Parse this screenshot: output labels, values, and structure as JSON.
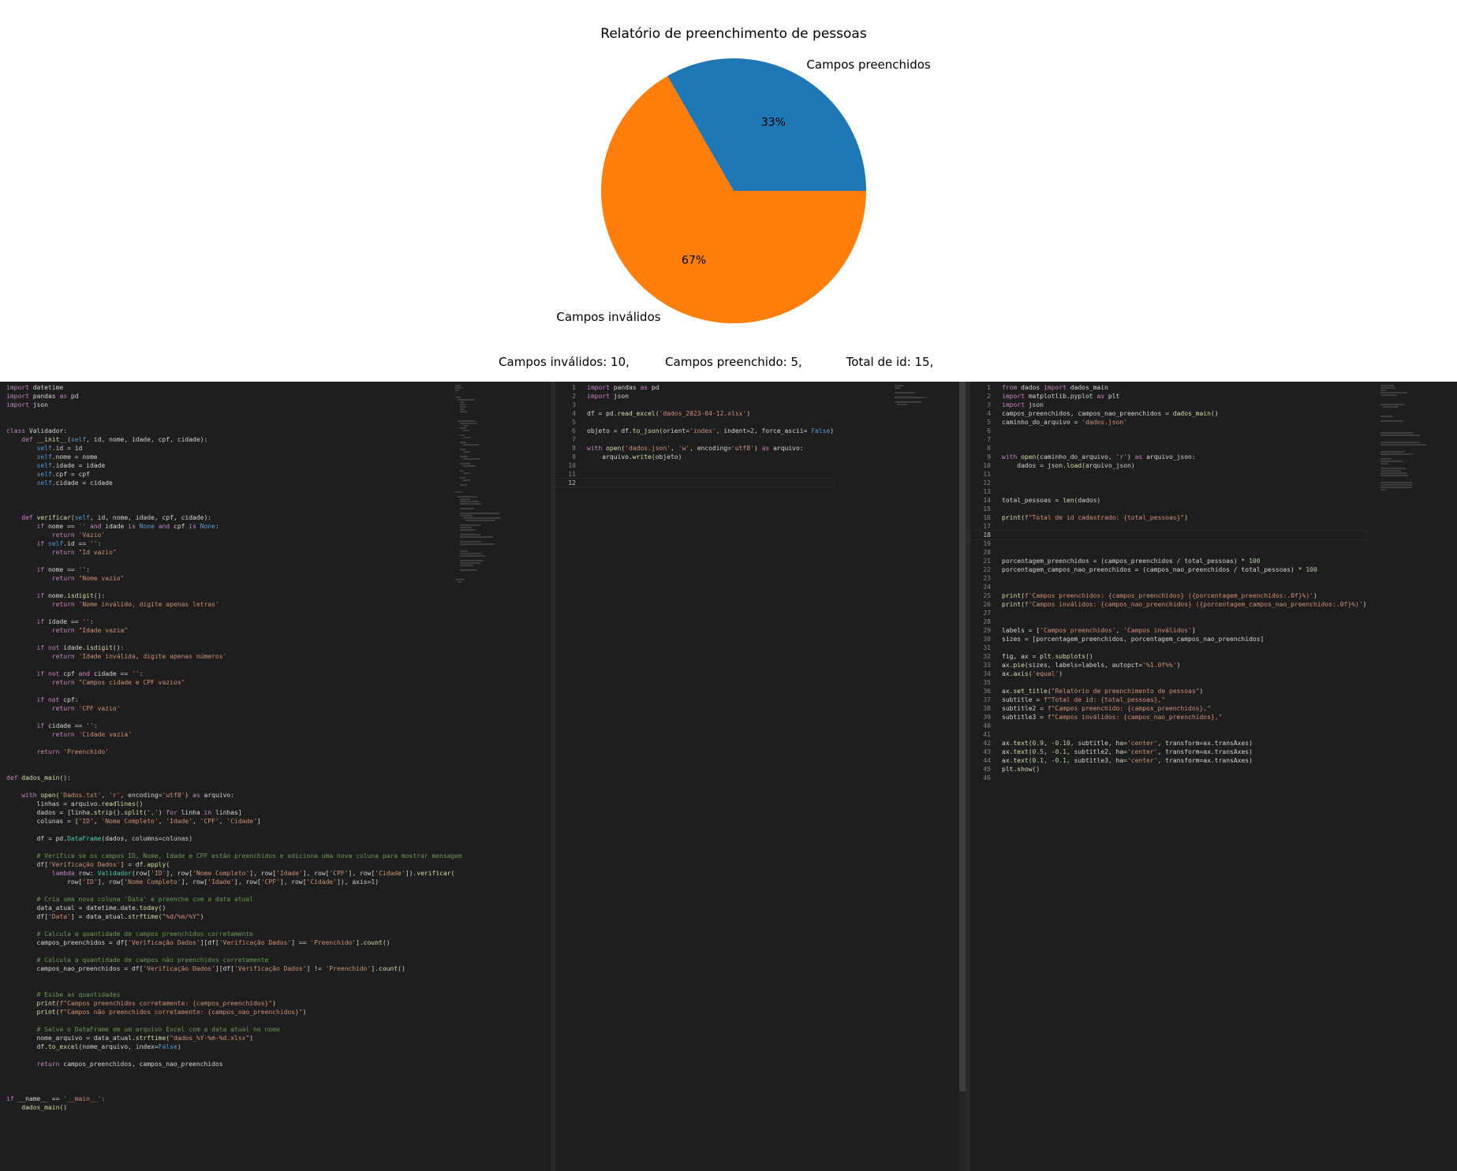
{
  "chart_data": {
    "type": "pie",
    "title": "Relatório de preenchimento de pessoas",
    "slices": [
      {
        "label": "Campos preenchidos",
        "value": 33.33,
        "pct_label": "33%",
        "color": "#1f77b4"
      },
      {
        "label": "Campos inválidos",
        "value": 66.67,
        "pct_label": "67%",
        "color": "#ff7f0e"
      }
    ],
    "subtitles": [
      "Campos inválidos: 10,",
      "Campos preenchido: 5,",
      "Total de id: 15,"
    ]
  },
  "editors": {
    "left": {
      "lines": [
        "import datetime",
        "import pandas as pd",
        "import json",
        "",
        "",
        "class Validador:",
        "    def __init__(self, id, nome, idade, cpf, cidade):",
        "        self.id = id",
        "        self.nome = nome",
        "        self.idade = idade",
        "        self.cpf = cpf",
        "        self.cidade = cidade",
        "",
        "",
        "",
        "    def verificar(self, id, nome, idade, cpf, cidade):",
        "        if nome == '' and idade is None and cpf is None:",
        "            return 'Vazio'",
        "        if self.id == '':",
        "            return \"Id vazio\"",
        "",
        "        if nome == '':",
        "            return \"Nome vazio\"",
        "",
        "        if nome.isdigit():",
        "            return 'Nome inválido, digite apenas letras'",
        "",
        "        if idade == '':",
        "            return \"Idade vazia\"",
        "",
        "        if not idade.isdigit():",
        "            return 'Idade inválida, digite apenas números'",
        "",
        "        if not cpf and cidade == '':",
        "            return \"Campos cidade e CPF vazios\"",
        "",
        "        if not cpf:",
        "            return 'CPF vazio'",
        "",
        "        if cidade == '':",
        "            return 'Cidade vazia'",
        "",
        "        return 'Preenchido'",
        "",
        "",
        "def dados_main():",
        "",
        "    with open('Dados.txt', 'r', encoding='utf8') as arquivo:",
        "        linhas = arquivo.readlines()",
        "        dados = [linha.strip().split(',') for linha in linhas]",
        "        colunas = ['ID', 'Nome Completo', 'Idade', 'CPF', 'Cidade']",
        "",
        "        df = pd.DataFrame(dados, columns=colunas)",
        "",
        "        # Verifica se os campos ID, Nome, Idade e CPF estão preenchidos e adiciona uma nova coluna para mostrar mensagem",
        "        df['Verificação Dados'] = df.apply(",
        "            lambda row: Validador(row['ID'], row['Nome Completo'], row['Idade'], row['CPF'], row['Cidade']).verificar(",
        "                row['ID'], row['Nome Completo'], row['Idade'], row['CPF'], row['Cidade']), axis=1)",
        "",
        "        # Cria uma nova coluna 'Data' e preenche com a data atual",
        "        data_atual = datetime.date.today()",
        "        df['Data'] = data_atual.strftime(\"%d/%m/%Y\")",
        "",
        "        # Calcula a quantidade de campos preenchidos corretamente",
        "        campos_preenchidos = df['Verificação Dados'][df['Verificação Dados'] == 'Preenchido'].count()",
        "",
        "        # Calcula a quantidade de campos não preenchidos corretamente",
        "        campos_nao_preenchidos = df['Verificação Dados'][df['Verificação Dados'] != 'Preenchido'].count()",
        "",
        "",
        "        # Exibe as quantidades",
        "        print(f\"Campos preenchidos corretamente: {campos_preenchidos}\")",
        "        print(f\"Campos não preenchidos corretamente: {campos_nao_preenchidos}\")",
        "",
        "        # Salva o DataFrame em um arquivo Excel com a data atual no nome",
        "        nome_arquivo = data_atual.strftime(\"dados_%Y-%m-%d.xlsx\")",
        "        df.to_excel(nome_arquivo, index=False)",
        "",
        "        return campos_preenchidos, campos_nao_preenchidos",
        "",
        "",
        "",
        "if __name__ == '__main__':",
        "    dados_main()"
      ]
    },
    "middle": {
      "lines": [
        "import pandas as pd",
        "import json",
        "",
        "df = pd.read_excel('dados_2023-04-12.xlsx')",
        "",
        "objeto = df.to_json(orient='index', indent=2, force_ascii= False)",
        "",
        "with open('dados.json', 'w', encoding='utf8') as arquivo:",
        "    arquivo.write(objeto)",
        "",
        "",
        ""
      ],
      "line_numbers": [
        "1",
        "2",
        "3",
        "4",
        "5",
        "6",
        "7",
        "8",
        "9",
        "10",
        "11",
        "12"
      ],
      "active_line": "12"
    },
    "right": {
      "lines": [
        "from dados import dados_main",
        "import matplotlib.pyplot as plt",
        "import json",
        "campos_preenchidos, campos_nao_preenchidos = dados_main()",
        "caminho_do_arquivo = 'dados.json'",
        "",
        "",
        "",
        "with open(caminho_do_arquivo, 'r') as arquivo_json:",
        "    dados = json.load(arquivo_json)",
        "",
        "",
        "",
        "total_pessoas = len(dados)",
        "",
        "print(f\"Total de id cadastrado: {total_pessoas}\")",
        "",
        "",
        "",
        "",
        "porcentagem_preenchidos = (campos_preenchidos / total_pessoas) * 100",
        "porcentagem_campos_nao_preenchidos = (campos_nao_preenchidos / total_pessoas) * 100",
        "",
        "",
        "print(f'Campos preenchidos: {campos_preenchidos} ({porcentagem_preenchidos:.0f}%)')",
        "print(f'Campos inválidos: {campos_nao_preenchidos} ({porcentagem_campos_nao_preenchidos:.0f}%)')",
        "",
        "",
        "labels = ['Campos preenchidos', 'Campos inválidos']",
        "sizes = [porcentagem_preenchidos, porcentagem_campos_nao_preenchidos]",
        "",
        "fig, ax = plt.subplots()",
        "ax.pie(sizes, labels=labels, autopct='%1.0f%%')",
        "ax.axis('equal')",
        "",
        "ax.set_title(\"Relatório de preenchimento de pessoas\")",
        "subtitle = f\"Total de id: {total_pessoas},\"",
        "subtitle2 = f\"Campos preenchido: {campos_preenchidos},\"",
        "subtitle3 = f\"Campos inválidos: {campos_nao_preenchidos},\"",
        "",
        "",
        "ax.text(0.9, -0.10, subtitle, ha='center', transform=ax.transAxes)",
        "ax.text(0.5, -0.1, subtitle2, ha='center', transform=ax.transAxes)",
        "ax.text(0.1, -0.1, subtitle3, ha='center', transform=ax.transAxes)",
        "plt.show()",
        ""
      ],
      "line_numbers": [
        "1",
        "2",
        "3",
        "4",
        "5",
        "6",
        "7",
        "8",
        "9",
        "10",
        "11",
        "12",
        "13",
        "14",
        "15",
        "16",
        "17",
        "18",
        "19",
        "20",
        "21",
        "22",
        "23",
        "24",
        "25",
        "26",
        "27",
        "28",
        "29",
        "30",
        "31",
        "32",
        "33",
        "34",
        "35",
        "36",
        "37",
        "38",
        "39",
        "40",
        "41",
        "42",
        "43",
        "44",
        "45",
        "46"
      ],
      "active_line": "18"
    }
  }
}
